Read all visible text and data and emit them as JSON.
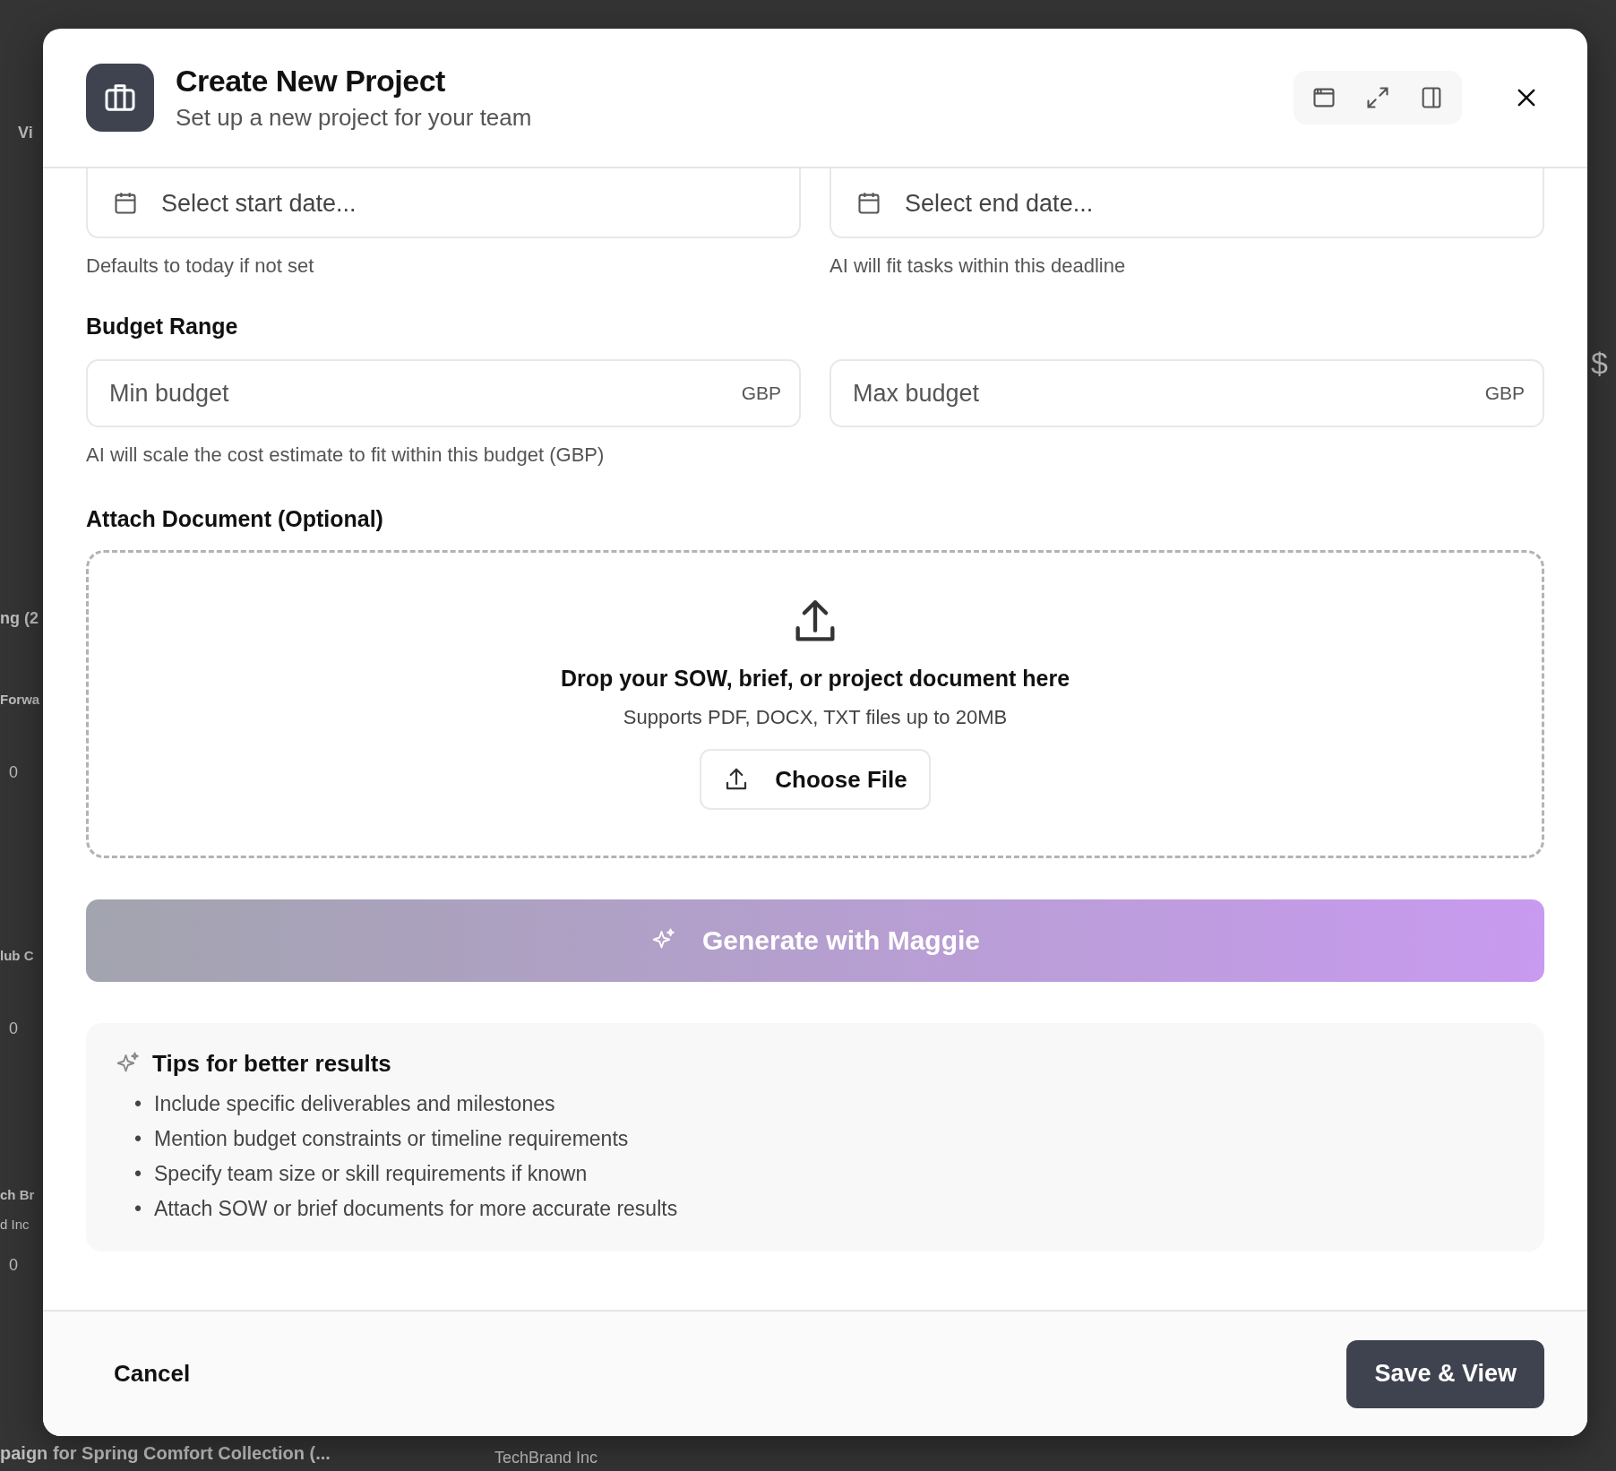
{
  "background_page": {
    "left_fragments": [
      {
        "text": "Vi",
        "kind": "heading"
      },
      {
        "text": "ng (2",
        "kind": "heading"
      },
      {
        "text": "Forwa",
        "kind": "title"
      },
      {
        "text": "0",
        "kind": "count"
      },
      {
        "text": "lub C",
        "kind": "title"
      },
      {
        "text": "0",
        "kind": "count"
      },
      {
        "text": "ch Br",
        "kind": "title"
      },
      {
        "text": "d Inc",
        "kind": "client"
      },
      {
        "text": "0",
        "kind": "count"
      }
    ],
    "bottom_fragments": [
      "paign for Spring Comfort Collection (...",
      "TechBrand Inc"
    ],
    "right_fragment": "$"
  },
  "dialog": {
    "title": "Create New Project",
    "subtitle": "Set up a new project for your team",
    "start_date": {
      "placeholder": "Select start date...",
      "hint": "Defaults to today if not set"
    },
    "end_date": {
      "placeholder": "Select end date...",
      "hint": "AI will fit tasks within this deadline"
    },
    "budget": {
      "label": "Budget Range",
      "fields": [
        {
          "placeholder": "Min budget",
          "currency": "GBP"
        },
        {
          "placeholder": "Max budget",
          "currency": "GBP"
        }
      ],
      "hint": "AI will scale the cost estimate to fit within this budget (GBP)"
    },
    "attachment": {
      "label": "Attach Document (Optional)",
      "title": "Drop your SOW, brief, or project document here",
      "subtitle": "Supports PDF, DOCX, TXT files up to 20MB",
      "button": "Choose File"
    },
    "generate_button": {
      "label": "Generate with Maggie",
      "disabled": true
    },
    "tips": {
      "title": "Tips for better results",
      "bullet": "•",
      "items": [
        "Include specific deliverables and milestones",
        "Mention budget constraints or timeline requirements",
        "Specify team size or skill requirements if known",
        "Attach SOW or brief documents for more accurate results"
      ]
    },
    "footer": {
      "cancel": "Cancel",
      "save": "Save & View"
    }
  }
}
